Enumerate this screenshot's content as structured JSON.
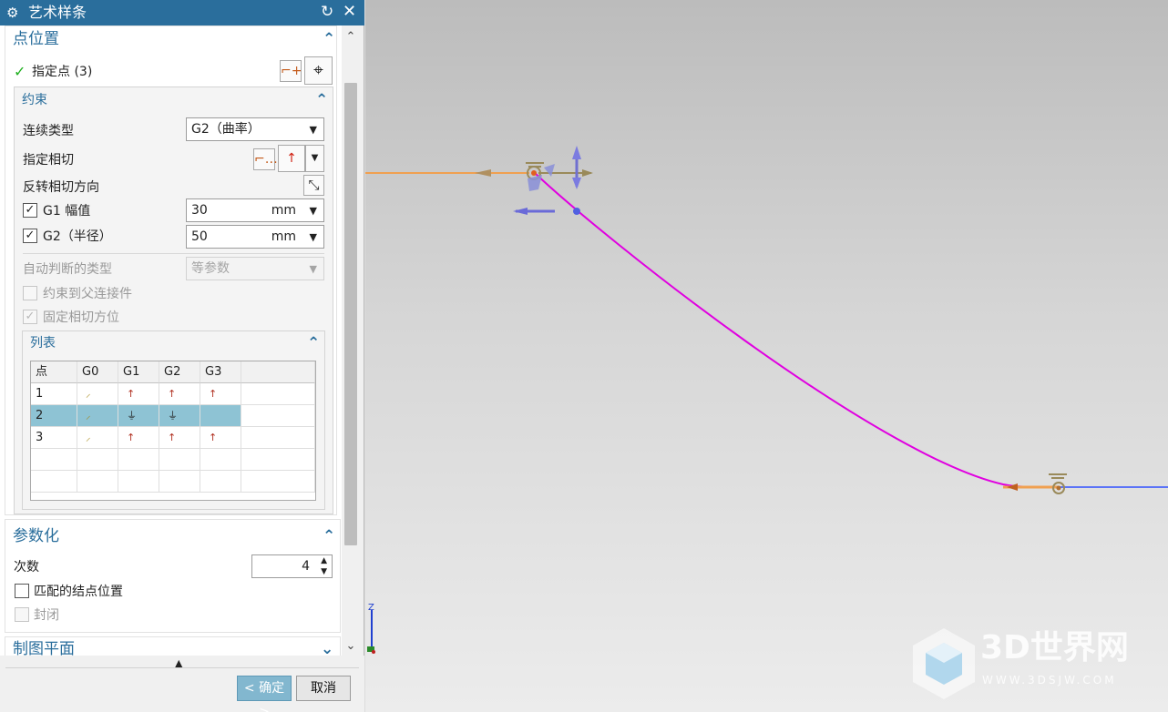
{
  "dialog": {
    "title": "艺术样条",
    "icon": "gear-icon",
    "reset_icon": "reset-icon",
    "close_icon": "close-icon"
  },
  "point_position": {
    "title": "点位置",
    "specify_point_label": "指定点 (3)",
    "constraint": {
      "title": "约束",
      "continuity_type_label": "连续类型",
      "continuity_type_value": "G2（曲率）",
      "specify_tangent_label": "指定相切",
      "reverse_tangent_label": "反转相切方向",
      "g1_magnitude_label": "G1 幅值",
      "g1_magnitude_value": "30",
      "g1_unit": "mm",
      "g1_checked": true,
      "g2_radius_label": "G2（半径）",
      "g2_radius_value": "50",
      "g2_unit": "mm",
      "g2_checked": true,
      "auto_infer_type_label": "自动判断的类型",
      "auto_infer_type_value": "等参数",
      "constrain_to_parent_label": "约束到父连接件",
      "fix_tangent_label": "固定相切方位",
      "list": {
        "title": "列表",
        "columns": [
          "点",
          "G0",
          "G1",
          "G2",
          "G3"
        ],
        "rows": [
          {
            "point": "1",
            "g0": "point-icon",
            "g1": "tangent-icon",
            "g2": "curvature-icon",
            "g3": "flow-icon",
            "selected": false
          },
          {
            "point": "2",
            "g0": "point-icon",
            "g1": "ground-icon",
            "g2": "ground-icon",
            "g3": "",
            "selected": true
          },
          {
            "point": "3",
            "g0": "point-icon",
            "g1": "tangent-icon",
            "g2": "curvature-icon",
            "g3": "flow-icon",
            "selected": false
          }
        ]
      }
    }
  },
  "parameterization": {
    "title": "参数化",
    "degree_label": "次数",
    "degree_value": "4",
    "match_knots_label": "匹配的结点位置",
    "match_knots_checked": false,
    "closed_label": "封闭",
    "closed_checked": false
  },
  "drawing_plane": {
    "title": "制图平面"
  },
  "footer": {
    "ok_label": "< 确定 >",
    "cancel_label": "取消"
  },
  "viewport": {
    "axis_z_label": "Z",
    "watermark_text": "3D世界网",
    "watermark_url": "WWW.3DSJW.COM",
    "spline_color": "#e000e0",
    "tangent_color": "#f0a050",
    "line_color": "#3050ff"
  }
}
